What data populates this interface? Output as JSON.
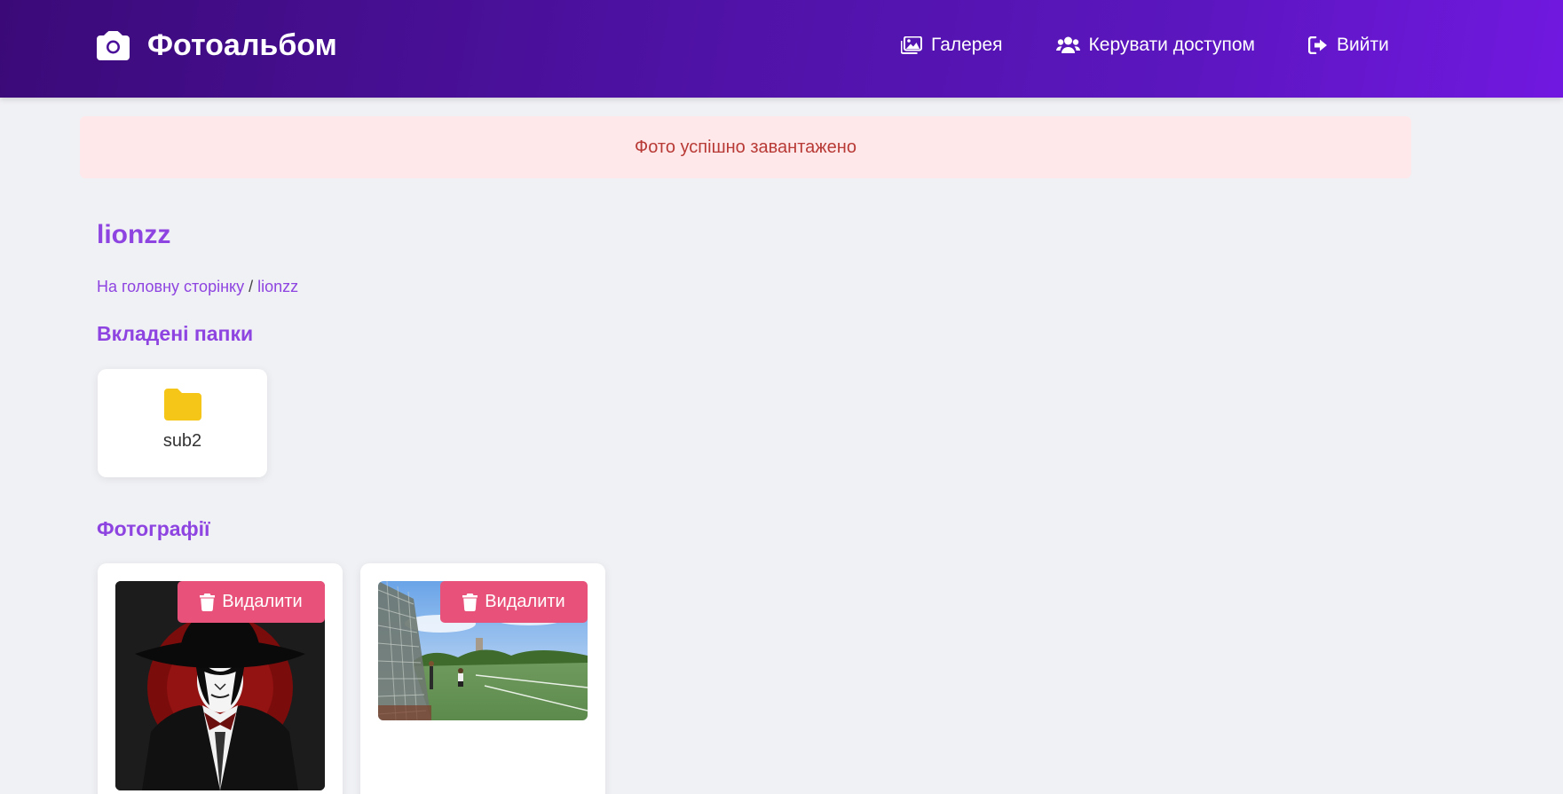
{
  "header": {
    "brand_title": "Фотоальбом",
    "brand_icon": "camera-icon",
    "nav": [
      {
        "label": "Галерея",
        "icon": "images-icon"
      },
      {
        "label": "Керувати доступом",
        "icon": "users-icon"
      },
      {
        "label": "Вийти",
        "icon": "sign-out-icon"
      }
    ]
  },
  "alert": {
    "message": "Фото успішно завантажено"
  },
  "page": {
    "title": "lionzz",
    "breadcrumb": {
      "home": "На головну сторінку",
      "separator": " / ",
      "current": "lionzz"
    }
  },
  "folders": {
    "heading": "Вкладені папки",
    "items": [
      {
        "name": "sub2",
        "icon": "folder-icon"
      }
    ]
  },
  "photos": {
    "heading": "Фотографії",
    "items": [
      {
        "delete_label": "Видалити",
        "subject": "stylized portrait in black hat"
      },
      {
        "delete_label": "Видалити",
        "subject": "tennis courts in a park"
      }
    ]
  },
  "colors": {
    "header_gradient_start": "#3b0a78",
    "header_gradient_end": "#7118e0",
    "accent": "#8e44e0",
    "alert_bg": "#ffe8ea",
    "alert_text": "#b83a36",
    "delete_button": "#e8527a",
    "folder": "#f5c518",
    "page_bg": "#f0f1f5"
  }
}
